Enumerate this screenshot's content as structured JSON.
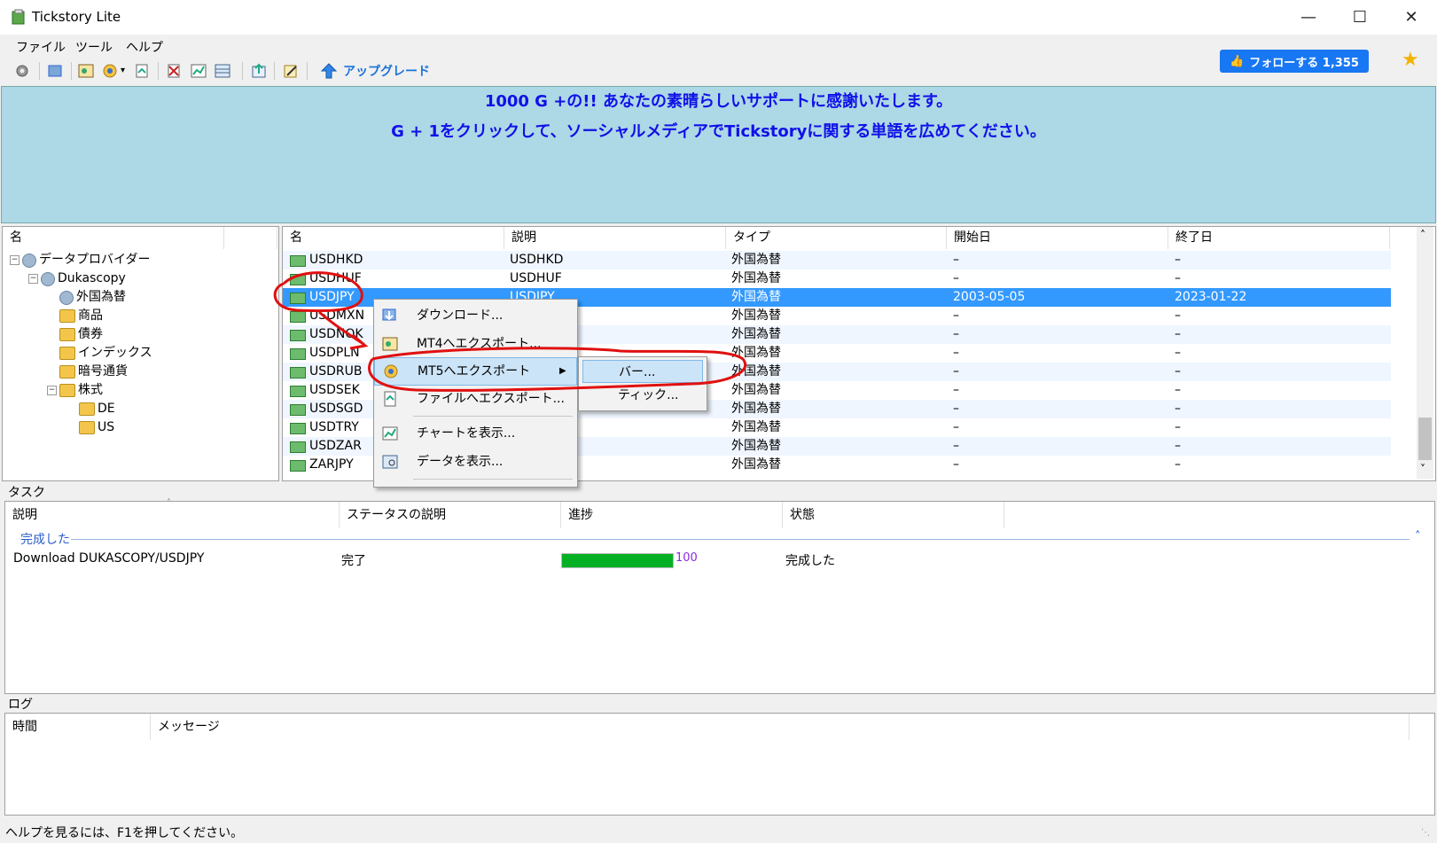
{
  "window": {
    "title": "Tickstory Lite"
  },
  "menubar": {
    "items": [
      "ファイル",
      "ツール",
      "ヘルプ"
    ]
  },
  "toolbar": {
    "upgrade_label": "アップグレード",
    "follow_label": "フォローする 1,355"
  },
  "banner": {
    "line1": "1000 G +の!! あなたの素晴らしいサポートに感謝いたします。",
    "line2": "G + 1をクリックして、ソーシャルメディアでTickstoryに関する単語を広めてください。"
  },
  "tree": {
    "header": "名",
    "root": "データプロバイダー",
    "provider": "Dukascopy",
    "categories": [
      "外国為替",
      "商品",
      "債券",
      "インデックス",
      "暗号通貨",
      "株式"
    ],
    "stocks_children": [
      "DE",
      "US"
    ]
  },
  "list": {
    "headers": [
      "名",
      "説明",
      "タイプ",
      "開始日",
      "終了日"
    ],
    "rows": [
      {
        "name": "USDHKD",
        "desc": "USDHKD",
        "type": "外国為替",
        "start": "–",
        "end": "–"
      },
      {
        "name": "USDHUF",
        "desc": "USDHUF",
        "type": "外国為替",
        "start": "–",
        "end": "–"
      },
      {
        "name": "USDJPY",
        "desc": "USDJPY",
        "type": "外国為替",
        "start": "2003-05-05",
        "end": "2023-01-22"
      },
      {
        "name": "USDMXN",
        "desc": "",
        "type": "外国為替",
        "start": "–",
        "end": "–"
      },
      {
        "name": "USDNOK",
        "desc": "",
        "type": "外国為替",
        "start": "–",
        "end": "–"
      },
      {
        "name": "USDPLN",
        "desc": "",
        "type": "外国為替",
        "start": "–",
        "end": "–"
      },
      {
        "name": "USDRUB",
        "desc": "",
        "type": "外国為替",
        "start": "–",
        "end": "–"
      },
      {
        "name": "USDSEK",
        "desc": "",
        "type": "外国為替",
        "start": "–",
        "end": "–"
      },
      {
        "name": "USDSGD",
        "desc": "",
        "type": "外国為替",
        "start": "–",
        "end": "–"
      },
      {
        "name": "USDTRY",
        "desc": "",
        "type": "外国為替",
        "start": "–",
        "end": "–"
      },
      {
        "name": "USDZAR",
        "desc": "",
        "type": "外国為替",
        "start": "–",
        "end": "–"
      },
      {
        "name": "ZARJPY",
        "desc": "",
        "type": "外国為替",
        "start": "–",
        "end": "–"
      }
    ]
  },
  "context_menu": {
    "items": [
      "ダウンロード...",
      "MT4へエクスポート...",
      "MT5へエクスポート",
      "ファイルへエクスポート...",
      "チャートを表示...",
      "データを表示..."
    ],
    "submenu": [
      "バー...",
      "ティック..."
    ]
  },
  "tasks": {
    "label": "タスク",
    "headers": [
      "説明",
      "ステータスの説明",
      "進捗",
      "状態"
    ],
    "group": "完成した",
    "row": {
      "desc": "Download DUKASCOPY/USDJPY",
      "status": "完了",
      "progress": 100,
      "progress_text": "100",
      "state": "完成した"
    }
  },
  "log": {
    "label": "ログ",
    "headers": [
      "時間",
      "メッセージ"
    ]
  },
  "statusbar": {
    "text": "ヘルプを見るには、F1を押してください。"
  },
  "colors": {
    "banner_bg": "#add8e6",
    "banner_text": "#1010e8",
    "selection": "#3399ff",
    "progress": "#06b025",
    "annotation": "#e01010"
  }
}
